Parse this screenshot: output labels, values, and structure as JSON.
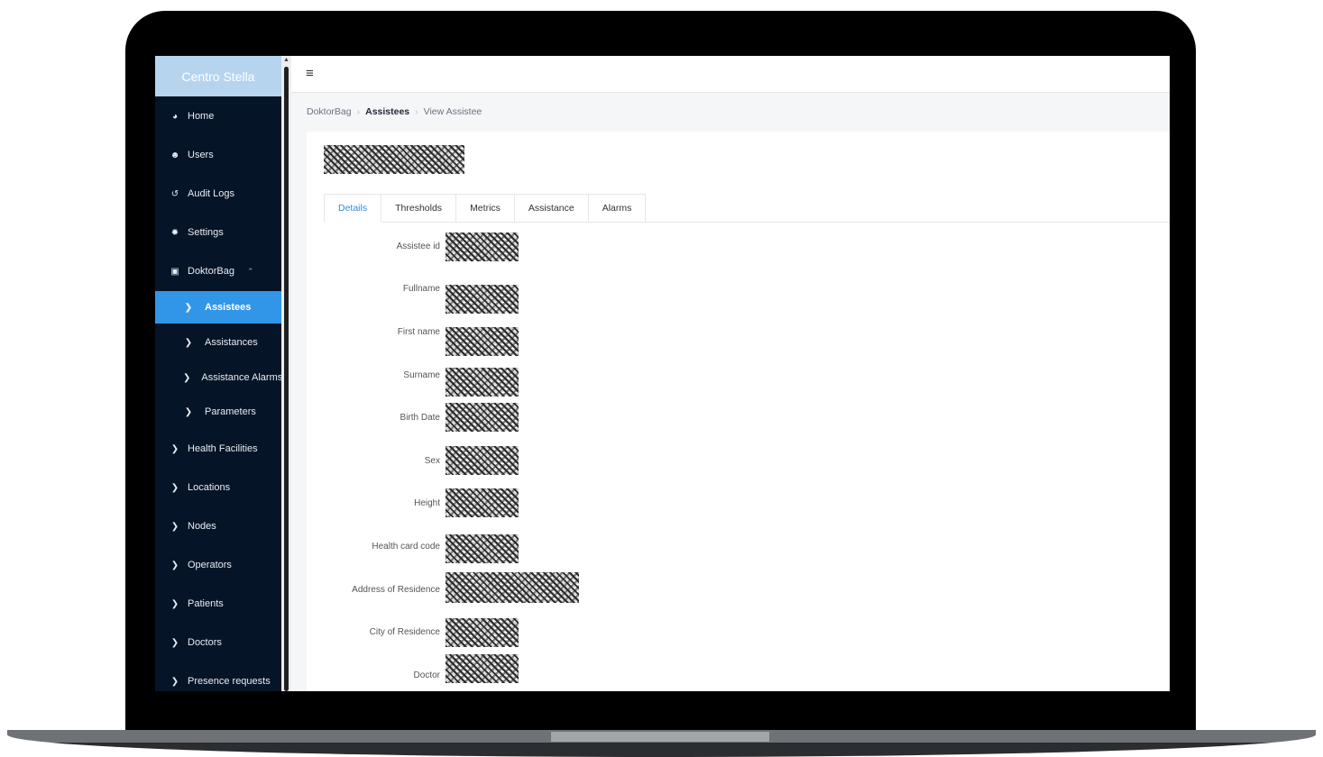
{
  "app": {
    "brand": "Centro Stella",
    "menu_icon": "hamburger-icon"
  },
  "sidebar": {
    "items": [
      {
        "label": "Home",
        "icon": "dashboard-icon"
      },
      {
        "label": "Users",
        "icon": "user-add-icon"
      },
      {
        "label": "Audit Logs",
        "icon": "history-icon"
      },
      {
        "label": "Settings",
        "icon": "gear-icon"
      },
      {
        "label": "DoktorBag",
        "icon": "medical-bag-icon",
        "expanded": true
      },
      {
        "label": "Assistees",
        "icon": "chevron-right-icon",
        "active": true
      },
      {
        "label": "Assistances",
        "icon": "chevron-right-icon"
      },
      {
        "label": "Assistance Alarms",
        "icon": "chevron-right-icon"
      },
      {
        "label": "Parameters",
        "icon": "chevron-right-icon"
      },
      {
        "label": "Health Facilities",
        "icon": "chevron-right-icon"
      },
      {
        "label": "Locations",
        "icon": "chevron-right-icon"
      },
      {
        "label": "Nodes",
        "icon": "chevron-right-icon"
      },
      {
        "label": "Operators",
        "icon": "chevron-right-icon"
      },
      {
        "label": "Patients",
        "icon": "chevron-right-icon"
      },
      {
        "label": "Doctors",
        "icon": "chevron-right-icon"
      },
      {
        "label": "Presence requests",
        "icon": "chevron-right-icon"
      }
    ],
    "active_color": "#3196e8",
    "background_color": "#051426"
  },
  "breadcrumb": {
    "root": "DoktorBag",
    "section": "Assistees",
    "page": "View Assistee"
  },
  "tabs": [
    {
      "label": "Details",
      "active": true
    },
    {
      "label": "Thresholds"
    },
    {
      "label": "Metrics"
    },
    {
      "label": "Assistance"
    },
    {
      "label": "Alarms"
    }
  ],
  "details": {
    "fields": [
      {
        "label": "Assistee id"
      },
      {
        "label": "Fullname"
      },
      {
        "label": "First name"
      },
      {
        "label": "Surname"
      },
      {
        "label": "Birth Date"
      },
      {
        "label": "Sex"
      },
      {
        "label": "Height"
      },
      {
        "label": "Health card code"
      },
      {
        "label": "Address of Residence"
      },
      {
        "label": "City of Residence"
      },
      {
        "label": "Doctor"
      }
    ]
  }
}
